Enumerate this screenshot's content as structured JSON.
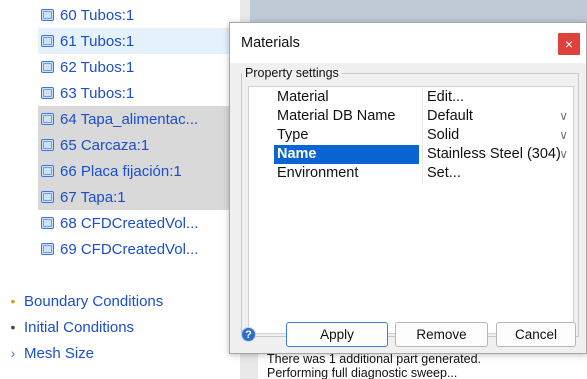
{
  "tree": {
    "parts": [
      {
        "label": "60 Tubos:1",
        "highlight": "none"
      },
      {
        "label": "61 Tubos:1",
        "highlight": "light"
      },
      {
        "label": "62 Tubos:1",
        "highlight": "none"
      },
      {
        "label": "63 Tubos:1",
        "highlight": "none"
      },
      {
        "label": "64 Tapa_alimentac...",
        "highlight": "gray"
      },
      {
        "label": "65 Carcaza:1",
        "highlight": "gray"
      },
      {
        "label": "66 Placa fijación:1",
        "highlight": "gray"
      },
      {
        "label": "67 Tapa:1",
        "highlight": "gray"
      },
      {
        "label": "68 CFDCreatedVol...",
        "highlight": "none"
      },
      {
        "label": "69 CFDCreatedVol...",
        "highlight": "none"
      }
    ],
    "nodes": [
      {
        "label": "Boundary Conditions",
        "icon": "boundary-conditions-icon"
      },
      {
        "label": "Initial Conditions",
        "icon": "initial-conditions-icon"
      },
      {
        "label": "Mesh Size",
        "icon": "mesh-size-icon"
      }
    ]
  },
  "dialog": {
    "title": "Materials",
    "close_glyph": "×",
    "group_label": "Property settings",
    "properties": [
      {
        "key": "Material",
        "value": "Edit...",
        "dropdown": false,
        "selected": false
      },
      {
        "key": "Material DB Name",
        "value": "Default",
        "dropdown": true,
        "selected": false
      },
      {
        "key": "Type",
        "value": "Solid",
        "dropdown": true,
        "selected": false
      },
      {
        "key": "Name",
        "value": "Stainless Steel (304)",
        "dropdown": true,
        "selected": true
      },
      {
        "key": "Environment",
        "value": "Set...",
        "dropdown": false,
        "selected": false
      }
    ],
    "buttons": {
      "apply": "Apply",
      "remove": "Remove",
      "cancel": "Cancel"
    },
    "help_glyph": "?"
  },
  "output": {
    "lines": [
      "There was 1 additional part generated.",
      "Performing full diagnostic sweep..."
    ]
  },
  "colors": {
    "tree_text": "#1a4fc9",
    "selection": "#0a64d2",
    "close_button": "#e0413c"
  }
}
